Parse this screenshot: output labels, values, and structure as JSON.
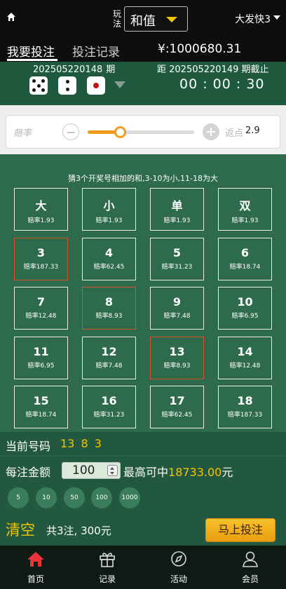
{
  "header": {
    "home_icon": "home-icon",
    "play_mode_label": "玩法",
    "play_mode_value": "和值",
    "lottery_name": "大发快3"
  },
  "tabs": {
    "bet_label": "我要投注",
    "history_label": "投注记录",
    "balance": "¥:1000680.31"
  },
  "issue": {
    "prev_number": "202505220148",
    "prev_suffix": "期",
    "dice": [
      5,
      2,
      1
    ],
    "next_text": "距 202505220149 期截止",
    "countdown": "00 : 00 : 30"
  },
  "rate": {
    "label": "赔率",
    "slider_fraction": 0.3,
    "rebate_label": "返点",
    "rebate_value": "2.9"
  },
  "hint": "猜3个开奖号相加的和,3-10为小,11-18为大",
  "cells": [
    {
      "label": "大",
      "odds": "赔率1.93",
      "selected": false
    },
    {
      "label": "小",
      "odds": "赔率1.93",
      "selected": false
    },
    {
      "label": "单",
      "odds": "赔率1.93",
      "selected": false
    },
    {
      "label": "双",
      "odds": "赔率1.93",
      "selected": false
    },
    {
      "label": "3",
      "odds": "赔率187.33",
      "selected": true
    },
    {
      "label": "4",
      "odds": "赔率62.45",
      "selected": false
    },
    {
      "label": "5",
      "odds": "赔率31.23",
      "selected": false
    },
    {
      "label": "6",
      "odds": "赔率18.74",
      "selected": false
    },
    {
      "label": "7",
      "odds": "赔率12.48",
      "selected": false
    },
    {
      "label": "8",
      "odds": "赔率8.93",
      "selected": true
    },
    {
      "label": "9",
      "odds": "赔率7.48",
      "selected": false
    },
    {
      "label": "10",
      "odds": "赔率6.95",
      "selected": false
    },
    {
      "label": "11",
      "odds": "赔率6.95",
      "selected": false
    },
    {
      "label": "12",
      "odds": "赔率7.48",
      "selected": false
    },
    {
      "label": "13",
      "odds": "赔率8.93",
      "selected": true
    },
    {
      "label": "14",
      "odds": "赔率12.48",
      "selected": false
    },
    {
      "label": "15",
      "odds": "赔率18.74",
      "selected": false
    },
    {
      "label": "16",
      "odds": "赔率31.23",
      "selected": false
    },
    {
      "label": "17",
      "odds": "赔率62.45",
      "selected": false
    },
    {
      "label": "18",
      "odds": "赔率187.33",
      "selected": false
    }
  ],
  "current": {
    "label": "当前号码",
    "numbers": "13 8 3"
  },
  "amount": {
    "label": "每注金额",
    "value": "100",
    "max_prefix": "最高可中",
    "max_value": "18733.00",
    "max_suffix": "元"
  },
  "chips": [
    "5",
    "10",
    "50",
    "100",
    "1000"
  ],
  "action": {
    "clear_label": "清空",
    "summary": "共3注, 300元",
    "submit_label": "马上投注"
  },
  "nav": [
    {
      "label": "首页",
      "icon": "home-icon"
    },
    {
      "label": "记录",
      "icon": "gift-icon"
    },
    {
      "label": "活动",
      "icon": "compass-icon"
    },
    {
      "label": "会员",
      "icon": "user-icon"
    }
  ],
  "colors": {
    "accent_yellow": "#f5c400",
    "slider_orange": "#f39a1d",
    "selected_border": "#d7542f",
    "nav_active": "#e8333b"
  }
}
